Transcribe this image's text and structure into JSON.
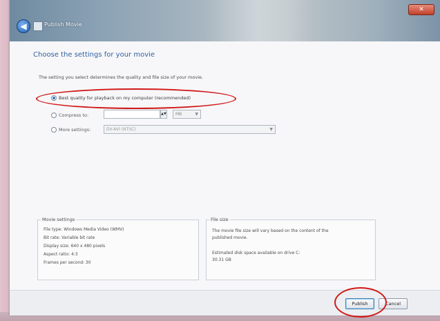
{
  "window": {
    "title": "Publish Movie",
    "close_glyph": "✕",
    "back_glyph": "◀"
  },
  "page": {
    "heading": "Choose the settings for your movie",
    "description": "The setting you select determines the quality and file size of your movie."
  },
  "options": {
    "best_quality": {
      "label": "Best quality for playback on my computer (recommended)",
      "selected": true
    },
    "compress": {
      "label": "Compress to:",
      "value": "",
      "spin_glyph": "▲▼",
      "unit": "MB",
      "caret": "▼",
      "selected": false
    },
    "more_settings": {
      "label": "More settings:",
      "value": "DV-AVI (NTSC)",
      "caret": "▼",
      "selected": false
    }
  },
  "movie_settings": {
    "title": "Movie settings",
    "lines": [
      "File type: Windows Media Video (WMV)",
      "Bit rate: Variable bit rate",
      "Display size: 640 x 480 pixels",
      "Aspect ratio: 4:3",
      "Frames per second: 30"
    ]
  },
  "file_size": {
    "title": "File size",
    "lines": [
      "The movie file size will vary based on the content of the",
      "published movie.",
      "",
      "Estimated disk space available on drive C:",
      "30.31 GB"
    ]
  },
  "footer": {
    "publish_label": "Publish",
    "cancel_label": "Cancel"
  },
  "colors": {
    "annotation": "#d01818",
    "heading": "#2f5fa0"
  }
}
